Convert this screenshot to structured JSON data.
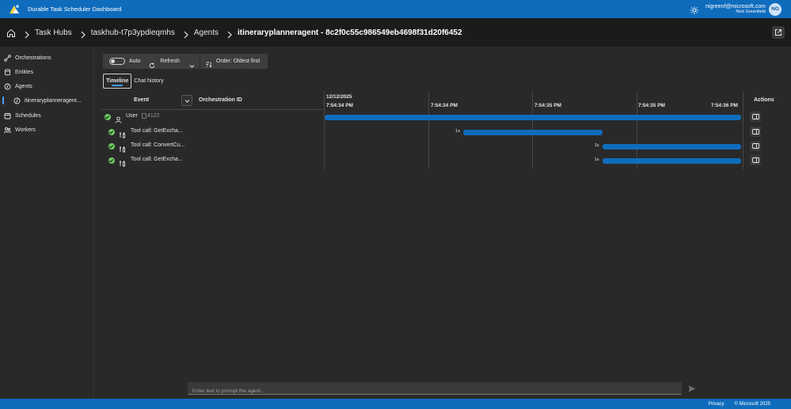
{
  "app": {
    "title": "Durable Task Scheduler Dashboard",
    "user_email": "nigreenf@microsoft.com",
    "user_name": "Nick Greenfield",
    "avatar_initials": "NG",
    "accent_color": "#0f6cbd"
  },
  "breadcrumb": {
    "items": [
      {
        "label": "Task Hubs"
      },
      {
        "label": "taskhub-t7p3ypdieqmhs"
      },
      {
        "label": "Agents"
      },
      {
        "label": "itineraryplanneragent - 8c2f0c55c986549eb4698f31d20f6452"
      }
    ]
  },
  "sidebar": {
    "items": [
      {
        "label": "Orchestrations",
        "icon": "flow-icon"
      },
      {
        "label": "Entities",
        "icon": "database-icon"
      },
      {
        "label": "Agents",
        "icon": "agent-icon"
      },
      {
        "label": "itineraryplanneragent...",
        "icon": "agent-icon",
        "active": true
      },
      {
        "label": "Schedules",
        "icon": "calendar-icon"
      },
      {
        "label": "Workers",
        "icon": "people-icon"
      }
    ]
  },
  "toolbar": {
    "auto_label": "Auto",
    "auto_on": false,
    "refresh_label": "Refresh",
    "order_label": "Order: Oldest first"
  },
  "tabs": [
    {
      "label": "Timeline",
      "selected": true
    },
    {
      "label": "Chat history",
      "selected": false
    }
  ],
  "grid": {
    "headers": {
      "event": "Event",
      "orchestration_id": "Orchestration ID",
      "actions": "Actions"
    },
    "date": "12/12/2025",
    "ticks": [
      "7:54:34 PM",
      "7:54:34 PM",
      "7:54:35 PM",
      "7:54:35 PM",
      "7:54:36 PM"
    ],
    "rows": [
      {
        "icon": "person-icon",
        "label": "User",
        "meta": "4122",
        "status": "completed",
        "duration": "",
        "start": 0.0,
        "end": 1.0
      },
      {
        "icon": "tool-icon",
        "label": "Tool call: GetExcha...",
        "meta": "",
        "status": "completed",
        "duration": "1s",
        "start": 0.333,
        "end": 0.667
      },
      {
        "icon": "tool-icon",
        "label": "Tool call: ConvertCu...",
        "meta": "",
        "status": "completed",
        "duration": "1s",
        "start": 0.667,
        "end": 1.0
      },
      {
        "icon": "tool-icon",
        "label": "Tool call: GetExcha...",
        "meta": "",
        "status": "completed",
        "duration": "1s",
        "start": 0.667,
        "end": 1.0
      }
    ]
  },
  "prompt": {
    "placeholder": "Enter text to prompt the agent..."
  },
  "footer": {
    "privacy": "Privacy",
    "copyright": "© Microsoft 2025"
  }
}
